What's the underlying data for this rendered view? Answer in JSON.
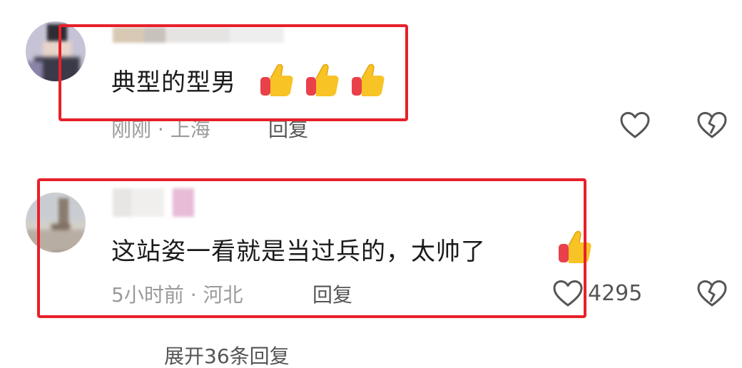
{
  "colors": {
    "highlight": "#e8202a",
    "meta_text": "#9a9a9a",
    "action_text": "#555555",
    "thumb_yellow": "#f7c325",
    "thumb_red": "#e9404a"
  },
  "comments": [
    {
      "text": "典型的型男",
      "emoji": [
        "thumbs-up",
        "thumbs-up",
        "thumbs-up"
      ],
      "meta": "刚刚 · 上海",
      "reply_label": "回复",
      "like_count": ""
    },
    {
      "text": "这站姿一看就是当过兵的，太帅了",
      "emoji": [
        "thumbs-up"
      ],
      "meta": "5小时前 · 河北",
      "reply_label": "回复",
      "like_count": "4295"
    }
  ],
  "expand_replies": "展开36条回复"
}
